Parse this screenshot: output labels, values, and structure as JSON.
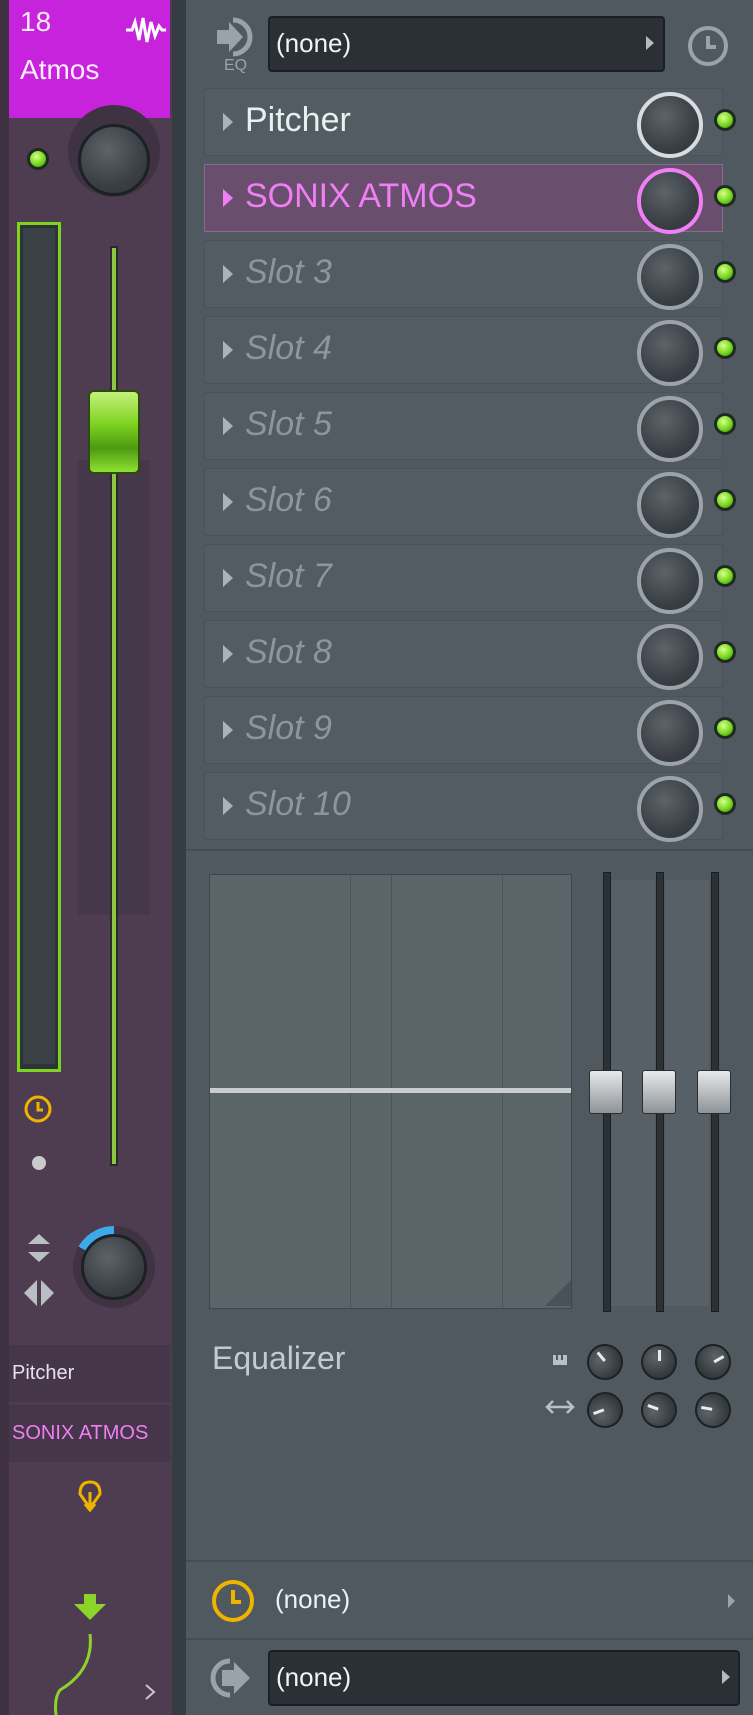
{
  "track": {
    "number": "18",
    "name": "Atmos"
  },
  "routing": {
    "eq_label": "EQ",
    "input_value": "(none)",
    "time_value": "(none)",
    "output_value": "(none)"
  },
  "slots": [
    {
      "label": "Pitcher",
      "active": true,
      "selected": false
    },
    {
      "label": "SONIX ATMOS",
      "active": true,
      "selected": true
    },
    {
      "label": "Slot 3",
      "active": false,
      "selected": false
    },
    {
      "label": "Slot 4",
      "active": false,
      "selected": false
    },
    {
      "label": "Slot 5",
      "active": false,
      "selected": false
    },
    {
      "label": "Slot 6",
      "active": false,
      "selected": false
    },
    {
      "label": "Slot 7",
      "active": false,
      "selected": false
    },
    {
      "label": "Slot 8",
      "active": false,
      "selected": false
    },
    {
      "label": "Slot 9",
      "active": false,
      "selected": false
    },
    {
      "label": "Slot 10",
      "active": false,
      "selected": false
    }
  ],
  "equalizer": {
    "label": "Equalizer"
  },
  "strip": {
    "plugin_list": [
      "Pitcher",
      "SONIX ATMOS"
    ]
  },
  "colors": {
    "track": "#c722dc",
    "selected_slot": "#f07ef5",
    "led": "#74d81e",
    "clock": "#f0b400"
  }
}
